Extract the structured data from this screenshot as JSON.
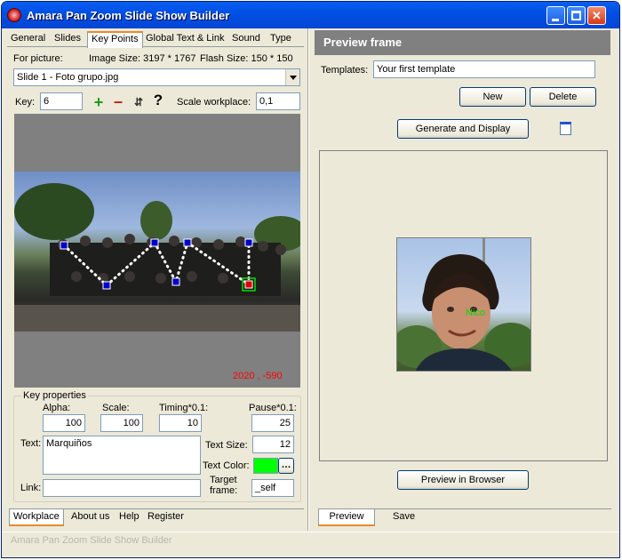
{
  "window": {
    "title": "Amara Pan Zoom Slide Show Builder"
  },
  "left": {
    "tabs": [
      "General",
      "Slides",
      "Key Points",
      "Global Text & Link",
      "Sound",
      "Type"
    ],
    "for_picture_label": "For picture:",
    "image_size": "Image Size: 3197 * 1767",
    "flash_size": "Flash Size: 150 * 150",
    "slide_select": "Slide 1 - Foto grupo.jpg",
    "key_label": "Key:",
    "key_value": "6",
    "scale_workplace_label": "Scale workplace:",
    "scale_workplace_value": "0,1",
    "toolbar_icons": {
      "add": "+",
      "remove": "–",
      "move": "⇵",
      "help": "?"
    },
    "coordinates": "2020 , -590",
    "key_properties": {
      "title": "Key properties",
      "alpha_label": "Alpha:",
      "alpha_value": "100",
      "scale_label": "Scale:",
      "scale_value": "100",
      "timing_label": "Timing*0.1:",
      "timing_value": "10",
      "pause_label": "Pause*0.1:",
      "pause_value": "25",
      "text_label": "Text:",
      "text_value": "Marquiños",
      "text_size_label": "Text Size:",
      "text_size_value": "12",
      "text_color_label": "Text Color:",
      "text_color": "#00ff00",
      "link_label": "Link:",
      "link_value": "",
      "target_label": "Target frame:",
      "target_value": "_self"
    },
    "bottom_tabs": [
      "Workplace",
      "About us",
      "Help",
      "Register"
    ]
  },
  "right": {
    "header": "Preview frame",
    "templates_label": "Templates:",
    "templates_value": "Your first template",
    "new_button": "New",
    "delete_button": "Delete",
    "generate_button": "Generate and Display",
    "face_label": "Nico",
    "preview_browser_button": "Preview in Browser",
    "bottom_tabs": [
      "Preview",
      "Save"
    ]
  },
  "statusbar": "Amara Pan Zoom Slide Show Builder",
  "colors": {
    "titlebar": "#0050e6",
    "accent_tab": "#e68b2c",
    "coord_text": "#ff0000",
    "label_text": "#00dd00"
  }
}
